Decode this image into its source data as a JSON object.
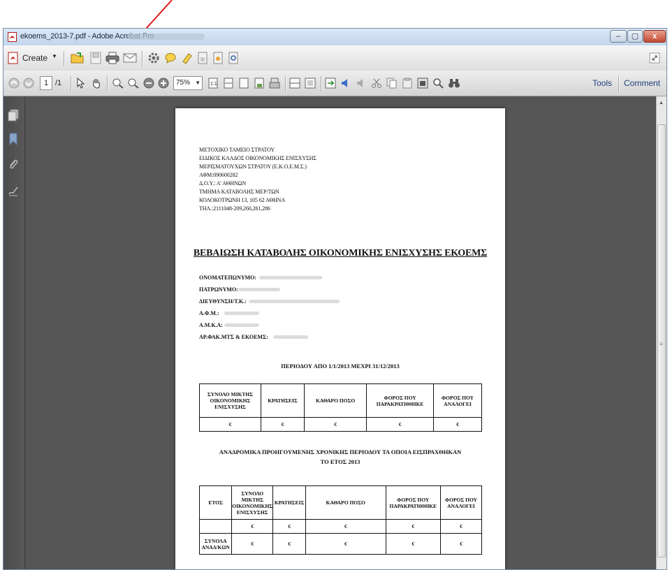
{
  "window": {
    "title": "ekoems_2013-7.pdf - Adobe Acrobat Pro",
    "minimize": "–",
    "maximize": "▢",
    "close": "x"
  },
  "toolbar": {
    "create_label": "Create",
    "current_page": "1",
    "total_pages": "/1",
    "zoom": "75%",
    "tools_label": "Tools",
    "comment_label": "Comment"
  },
  "document": {
    "header_lines": [
      "ΜΕΤΟΧΙΚΟ ΤΑΜΕΙΟ ΣΤΡΑΤΟΥ",
      "ΕΙΔΙΚΟΣ ΚΛΑΔΟΣ ΟΙΚΟΝΟΜΙΚΗΣ ΕΝΙΣΧΥΣΗΣ",
      "ΜΕΡΙΣΜΑΤΟΥΧΩΝ ΣΤΡΑΤΟΥ (Ε.Κ.Ο.Ε.Μ.Σ.)",
      "ΑΦΜ:090600282",
      "Δ.Ο.Υ.: Α' ΑΘΗΝΩΝ",
      "ΤΜΗΜΑ ΚΑΤΑΒΟΛΗΣ ΜΕΡ/ΤΩΝ",
      "ΚΟΛΟΚΟΤΡΩΝΗ 13, 105 62 ΑΘΗΝΑ",
      "ΤΗΛ.:2111048-209,260,261,286"
    ],
    "title": "ΒΕΒΑΙΩΣΗ ΚΑΤΑΒΟΛΗΣ ΟΙΚΟΝΟΜΙΚΗΣ ΕΝΙΣΧΥΣΗΣ ΕΚΟΕΜΣ",
    "fields": [
      "ΟΝΟΜΑΤΕΠΩΝΥΜΟ:",
      "ΠΑΤΡΩΝΥΜΟ:",
      "ΔΙΕΥΘΥΝΣΗ/Τ.Κ.:",
      "Α.Φ.Μ.:",
      "Α.Μ.Κ.Α:",
      "ΑΡ.ΦΑΚ.ΜΤΣ & ΕΚΟΕΜΣ:"
    ],
    "period": "ΠΕΡΙΟΔΟΥ ΑΠΟ 1/1/2013 ΜΕΧΡΙ 31/12/2013",
    "table1": {
      "headers": [
        "ΣΥΝΟΛΟ ΜΙΚΤΗΣ ΟΙΚΟΝΟΜΙΚΗΣ ΕΝΙΣΧΥΣΗΣ",
        "ΚΡΑΤΗΣΕΙΣ",
        "ΚΑΘΑΡΟ ΠΟΣΟ",
        "ΦΟΡΟΣ ΠΟΥ ΠΑΡΑΚΡΑΤΗΘΗΚΕ",
        "ΦΟΡΟΣ ΠΟΥ ΑΝΑΛΟΓΕΙ"
      ],
      "row": [
        "€",
        "€",
        "€",
        "€",
        "€"
      ]
    },
    "retro_title_1": "ΑΝΑΔΡΟΜΙΚΑ ΠΡΟΗΓΟΥΜΕΝΗΣ ΧΡΟΝΙΚΗΣ ΠΕΡΙΟΔΟΥ ΤΑ ΟΠΟΙΑ ΕΙΣΠΡΑΧΘΗΚΑΝ",
    "retro_title_2": "ΤΟ ΕΤΟΣ 2013",
    "table2": {
      "headers": [
        "ΕΤΟΣ",
        "ΣΥΝΟΛΟ ΜΙΚΤΗΣ ΟΙΚΟΝΟΜΙΚΗΣ ΕΝΙΣΧΥΣΗΣ",
        "ΚΡΑΤΗΣΕΙΣ",
        "ΚΑΘΑΡΟ ΠΟΣΟ",
        "ΦΟΡΟΣ ΠΟΥ ΠΑΡΑΚΡΑΤΗΘΗΚΕ",
        "ΦΟΡΟΣ ΠΟΥ ΑΝΑΛΟΓΕΙ"
      ],
      "row1": [
        "",
        "€",
        "€",
        "€",
        "€",
        "€"
      ],
      "total_label": "ΣΥΝΟΛΑ ΑΝΑΔ/ΚΩΝ",
      "row2": [
        "€",
        "€",
        "€",
        "€",
        "€"
      ]
    }
  },
  "colors": {
    "annotation_arrow": "#e0191c",
    "viewer_bg": "#555555",
    "left_panel": "#4f4f4f"
  }
}
